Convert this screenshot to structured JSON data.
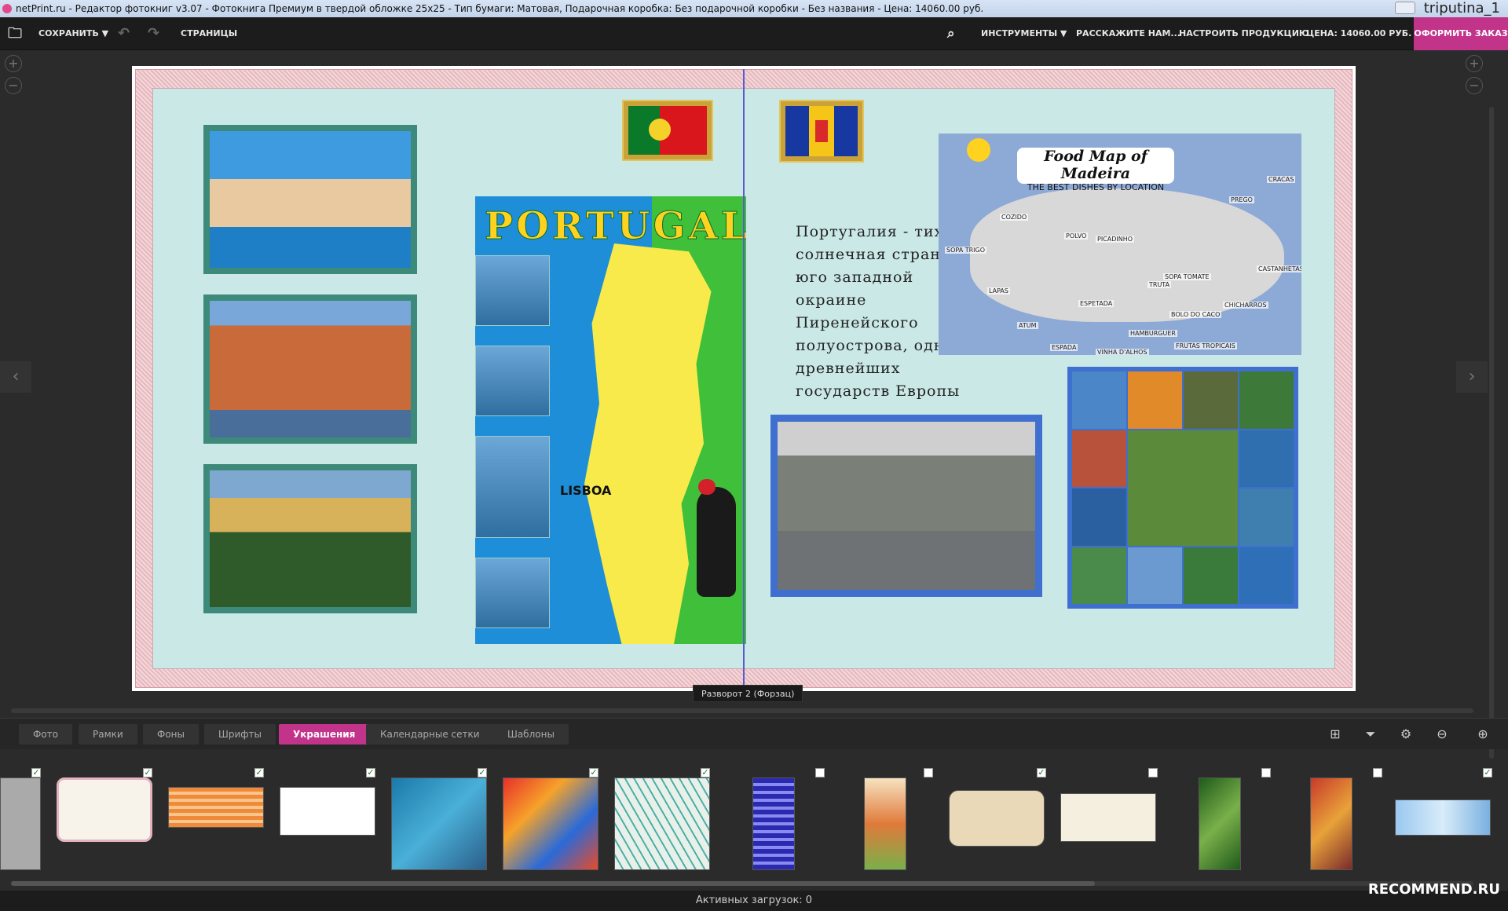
{
  "window": {
    "title": "netPrint.ru - Редактор фотокниг v3.07 - Фотокнига Премиум в твердой обложке 25x25 - Тип бумаги: Матовая, Подарочная коробка: Без подарочной коробки - Без названия - Цена: 14060.00 руб.",
    "user": "triputina_1"
  },
  "toolbar": {
    "save_label": "СОХРАНИТЬ ▼",
    "pages_label": "СТРАНИЦЫ",
    "tools_label": "ИНСТРУМЕНТЫ ▼",
    "tell_label": "РАССКАЖИТЕ НАМ...",
    "configure_label": "НАСТРОИТЬ ПРОДУКЦИЮ",
    "price_label": "ЦЕНА: 14060.00 РУБ. ▼",
    "order_label": "ОФОРМИТЬ ЗАКАЗ"
  },
  "canvas": {
    "map_title": "PORTUGAL",
    "map_city": "LISBOA",
    "body_text": "Португалия - тихая солнечная страна на юго западной окраине Пиренейского полуострова, одно из древнейших государств Европы",
    "food_map_title": "Food Map of Madeira",
    "food_map_subtitle": "THE BEST DISHES BY LOCATION",
    "dishes": [
      "CRACAS",
      "PREGO",
      "COZIDO",
      "POLVO",
      "PICADINHO",
      "SOPA TRIGO",
      "LAPAS",
      "ESPETADA",
      "TRUTA",
      "SOPA TOMATE",
      "CASTANHETAS",
      "CHICHARROS",
      "BOLO DO CACO",
      "HAMBURGUER",
      "FRUTAS TROPICAIS",
      "ESPADA",
      "VINHA D'ALHOS",
      "ATUM"
    ],
    "spread_label": "Разворот 2 (Форзац)"
  },
  "tabs": [
    "Фото",
    "Рамки",
    "Фоны",
    "Шрифты",
    "Украшения",
    "Календарные сетки",
    "Шаблоны"
  ],
  "status": {
    "uploads": "Активных загрузок: 0",
    "watermark": "RECOMMEND.RU"
  }
}
